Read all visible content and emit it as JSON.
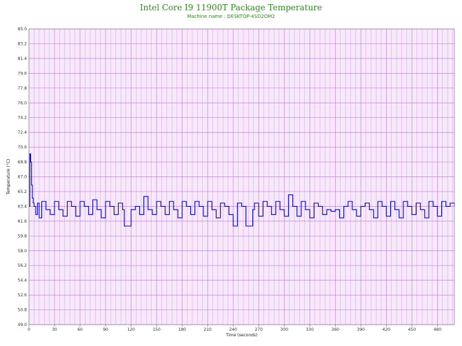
{
  "chart_data": {
    "type": "line",
    "title": "Intel Core I9 11900T Package Temperature",
    "subtitle": "Machine name : DESKTOP-4SD2OM2",
    "xlabel": "Time (seconds)",
    "ylabel": "Temperature (°C)",
    "xlim": [
      0,
      500
    ],
    "ylim": [
      49.0,
      85.0
    ],
    "x_ticks": [
      "0",
      "30",
      "60",
      "90",
      "120",
      "150",
      "180",
      "210",
      "240",
      "270",
      "300",
      "330",
      "360",
      "390",
      "420",
      "450",
      "480"
    ],
    "y_ticks": [
      "49.0",
      "50.8",
      "52.6",
      "54.4",
      "56.2",
      "58.0",
      "59.8",
      "61.6",
      "63.4",
      "65.2",
      "67.0",
      "68.8",
      "70.6",
      "72.4",
      "74.2",
      "76.0",
      "77.8",
      "79.6",
      "81.4",
      "83.2",
      "85.0"
    ],
    "grid": true,
    "colors": {
      "line": "#0000cc",
      "plot_bg": "#f8e8fc",
      "grid": "#c080d8",
      "title": "#2e8b1e"
    },
    "series": [
      {
        "x": [
          0,
          1,
          2,
          3,
          4,
          5,
          6,
          8,
          10,
          12,
          15,
          20,
          25,
          30,
          35,
          40,
          45,
          50,
          55,
          60,
          65,
          70,
          75,
          80,
          85,
          90,
          95,
          100,
          105,
          110,
          112,
          115,
          118,
          120,
          125,
          130,
          135,
          140,
          145,
          150,
          155,
          160,
          165,
          170,
          175,
          180,
          185,
          190,
          195,
          200,
          205,
          210,
          215,
          220,
          225,
          230,
          235,
          240,
          242,
          245,
          250,
          255,
          257,
          260,
          263,
          265,
          270,
          275,
          280,
          285,
          290,
          295,
          300,
          305,
          310,
          315,
          320,
          325,
          330,
          335,
          340,
          345,
          350,
          355,
          360,
          365,
          370,
          375,
          380,
          385,
          390,
          395,
          400,
          405,
          410,
          415,
          420,
          425,
          430,
          435,
          440,
          445,
          450,
          455,
          460,
          465,
          470,
          475,
          480,
          485,
          490,
          495,
          500
        ],
        "y": [
          63.4,
          69.8,
          68.8,
          66.0,
          64.4,
          63.8,
          63.4,
          62.4,
          63.8,
          62.0,
          64.0,
          63.0,
          62.4,
          64.0,
          63.0,
          62.2,
          64.0,
          63.4,
          62.2,
          64.0,
          63.4,
          62.4,
          64.2,
          63.0,
          62.0,
          64.0,
          63.4,
          62.4,
          63.8,
          63.0,
          61.0,
          61.0,
          61.0,
          63.0,
          63.4,
          62.4,
          64.6,
          63.0,
          62.4,
          64.0,
          63.4,
          62.4,
          64.0,
          63.0,
          62.0,
          64.0,
          63.4,
          62.4,
          64.0,
          63.4,
          62.2,
          64.0,
          63.0,
          62.0,
          63.8,
          63.4,
          62.4,
          61.0,
          61.0,
          63.8,
          63.4,
          61.0,
          61.0,
          61.0,
          63.0,
          63.8,
          62.2,
          64.0,
          63.4,
          62.4,
          64.0,
          63.0,
          62.2,
          64.8,
          63.4,
          62.2,
          64.0,
          63.0,
          62.0,
          63.8,
          63.4,
          62.4,
          63.0,
          62.8,
          63.0,
          62.0,
          63.4,
          64.0,
          63.0,
          62.2,
          63.4,
          63.8,
          63.0,
          62.0,
          64.0,
          63.4,
          62.2,
          64.0,
          63.0,
          62.0,
          64.0,
          63.4,
          62.4,
          63.8,
          63.0,
          62.0,
          64.0,
          63.4,
          62.2,
          64.0,
          63.4,
          63.8,
          63.4
        ]
      }
    ]
  }
}
